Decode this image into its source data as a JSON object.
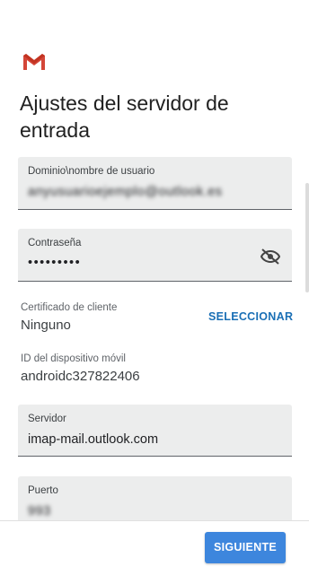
{
  "app": {
    "logo_icon": "gmail-logo-icon"
  },
  "page": {
    "title": "Ajustes del servidor de entrada"
  },
  "domain_field": {
    "label": "Dominio\\nombre de usuario",
    "value": "anyusuarioejemplo@outlook.es"
  },
  "password_field": {
    "label": "Contraseña",
    "value": "•••••••••",
    "toggle_icon": "visibility-off-icon"
  },
  "certificate": {
    "label": "Certificado de cliente",
    "value": "Ninguno",
    "action_label": "SELECCIONAR"
  },
  "device": {
    "label": "ID del dispositivo móvil",
    "value": "androidc327822406"
  },
  "server_field": {
    "label": "Servidor",
    "value": "imap-mail.outlook.com"
  },
  "port_field": {
    "label": "Puerto",
    "value": "993"
  },
  "footer": {
    "next_label": "SIGUIENTE"
  },
  "colors": {
    "accent": "#3d86dd",
    "link": "#1a6fb5",
    "field_bg": "#eceded"
  }
}
